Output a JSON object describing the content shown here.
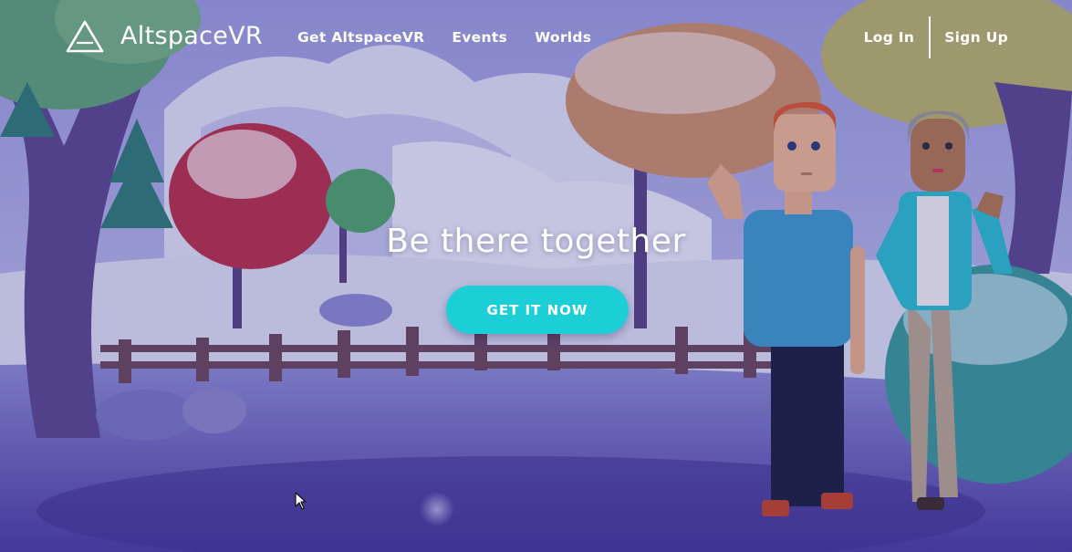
{
  "header": {
    "logo_text": "AltspaceVR",
    "logo_icon": "triangle-logo-icon",
    "nav": [
      {
        "label": "Get AltspaceVR"
      },
      {
        "label": "Events"
      },
      {
        "label": "Worlds"
      }
    ],
    "login_label": "Log In",
    "signup_label": "Sign Up"
  },
  "hero": {
    "title": "Be there together",
    "cta_label": "GET IT NOW"
  },
  "colors": {
    "accent": "#1ccfd6",
    "text": "#ffffff",
    "scene_sky": "#8d8fd8",
    "snow": "#e6e8f8"
  },
  "icons": {
    "cursor": "mouse-pointer-icon"
  }
}
